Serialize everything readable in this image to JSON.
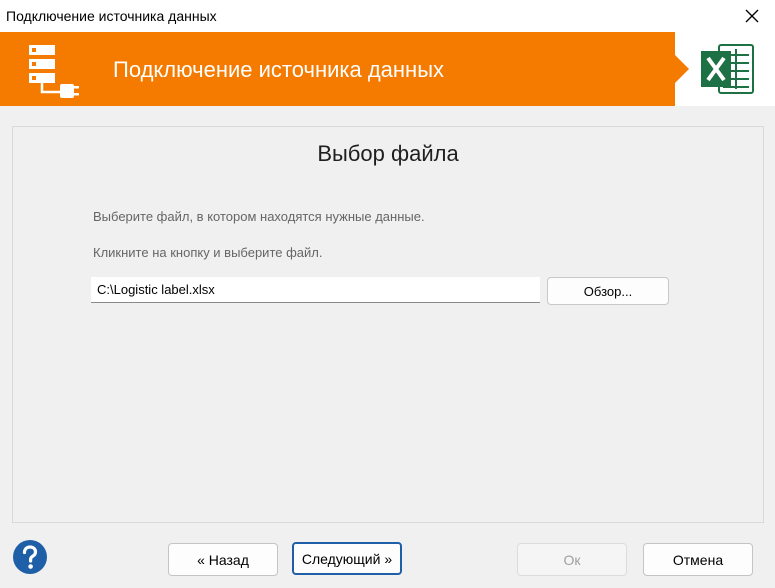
{
  "window": {
    "title": "Подключение источника данных",
    "close_icon": "close-icon"
  },
  "banner": {
    "title": "Подключение источника данных",
    "brand_color": "#f47a00",
    "left_icon": "data-source-plug-icon",
    "right_icon": "excel-icon"
  },
  "main": {
    "heading": "Выбор файла",
    "description_1": "Выберите файл, в котором находятся нужные данные.",
    "description_2": "Кликните на кнопку и выберите файл.",
    "file_path": "C:\\Logistic label.xlsx",
    "browse_label": "Обзор..."
  },
  "footer": {
    "help_icon": "help-icon",
    "back_label": "« Назад",
    "next_label": "Следующий »",
    "ok_label": "Ок",
    "cancel_label": "Отмена",
    "accent_color": "#1f5fa8"
  }
}
